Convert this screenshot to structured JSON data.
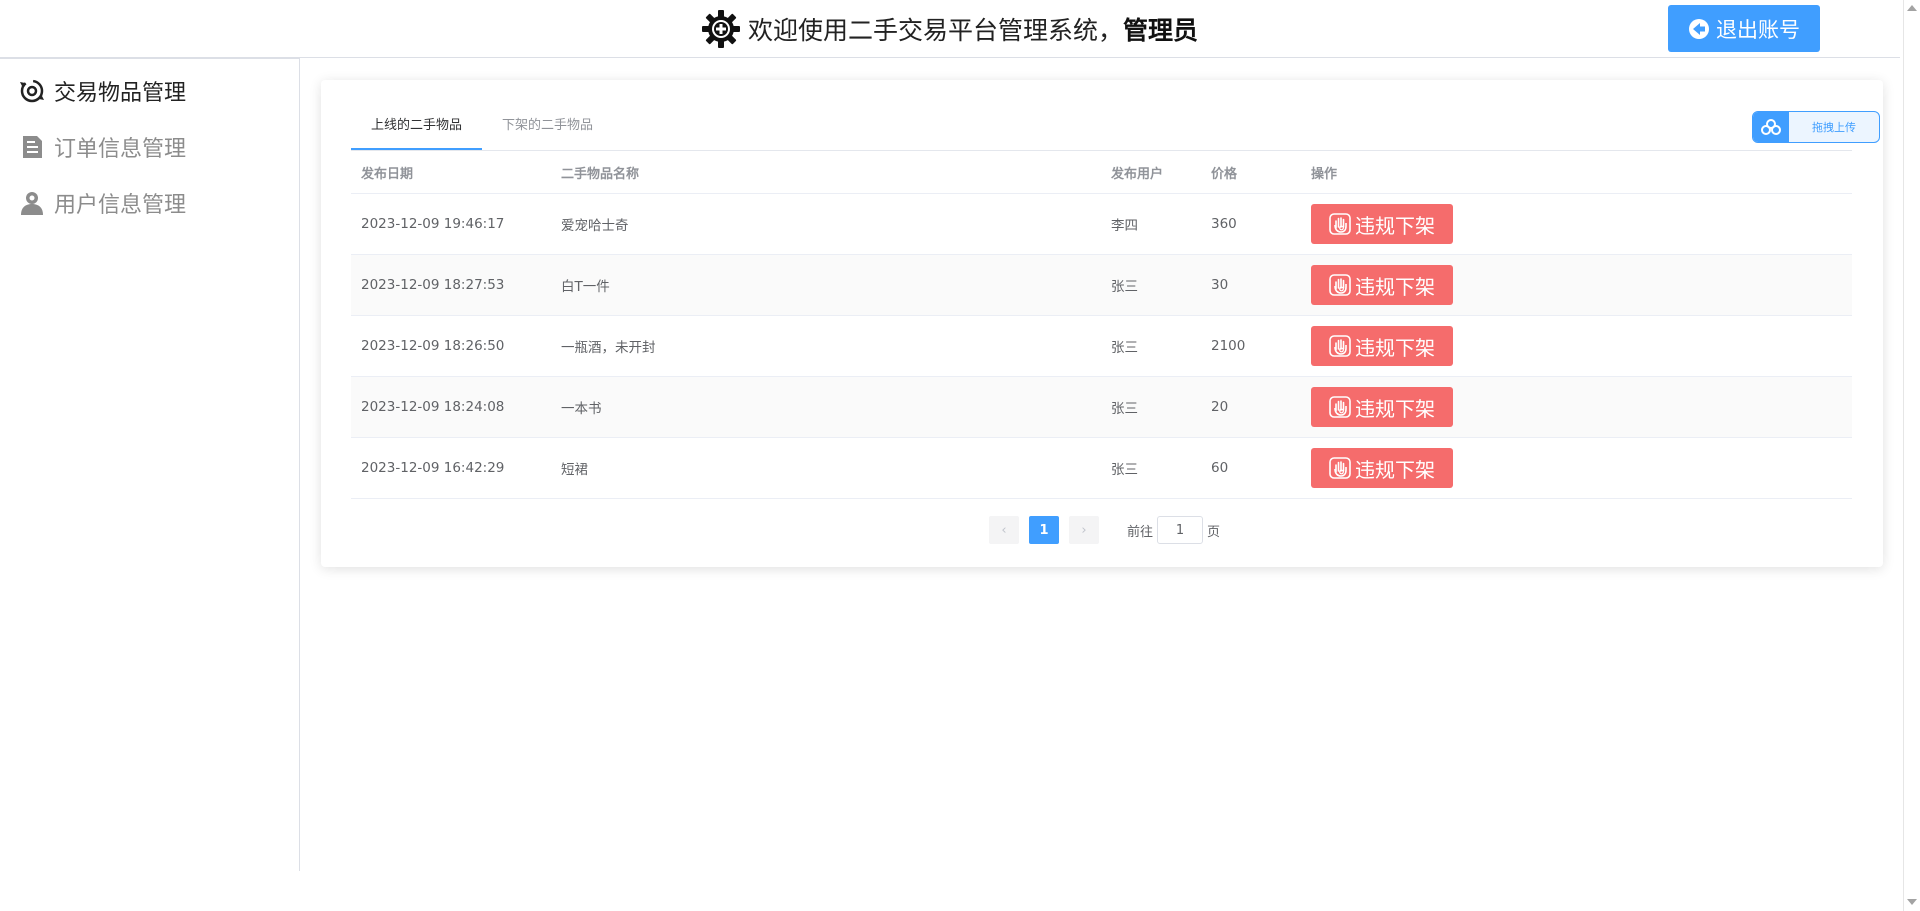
{
  "header": {
    "title": "欢迎使用二手交易平台管理系统，",
    "role": "管理员",
    "logout_label": "退出账号"
  },
  "sidebar": {
    "items": [
      {
        "label": "交易物品管理",
        "icon": "trade-icon",
        "active": true
      },
      {
        "label": "订单信息管理",
        "icon": "document-icon",
        "active": false
      },
      {
        "label": "用户信息管理",
        "icon": "user-icon",
        "active": false
      }
    ]
  },
  "tabs": [
    {
      "label": "上线的二手物品",
      "active": true
    },
    {
      "label": "下架的二手物品",
      "active": false
    }
  ],
  "upload": {
    "label": "拖拽上传"
  },
  "table": {
    "headers": {
      "date": "发布日期",
      "name": "二手物品名称",
      "user": "发布用户",
      "price": "价格",
      "op": "操作"
    },
    "rows": [
      {
        "date": "2023-12-09 19:46:17",
        "name": "爱宠哈士奇",
        "user": "李四",
        "price": "360",
        "action": "违规下架"
      },
      {
        "date": "2023-12-09 18:27:53",
        "name": "白T一件",
        "user": "张三",
        "price": "30",
        "action": "违规下架"
      },
      {
        "date": "2023-12-09 18:26:50",
        "name": "一瓶酒，未开封",
        "user": "张三",
        "price": "2100",
        "action": "违规下架"
      },
      {
        "date": "2023-12-09 18:24:08",
        "name": "一本书",
        "user": "张三",
        "price": "20",
        "action": "违规下架"
      },
      {
        "date": "2023-12-09 16:42:29",
        "name": "短裙",
        "user": "张三",
        "price": "60",
        "action": "违规下架"
      }
    ]
  },
  "pagination": {
    "current_page": "1",
    "goto_prefix": "前往",
    "goto_value": "1",
    "goto_suffix": "页"
  },
  "colors": {
    "primary": "#409eff",
    "danger": "#f56c6c"
  }
}
